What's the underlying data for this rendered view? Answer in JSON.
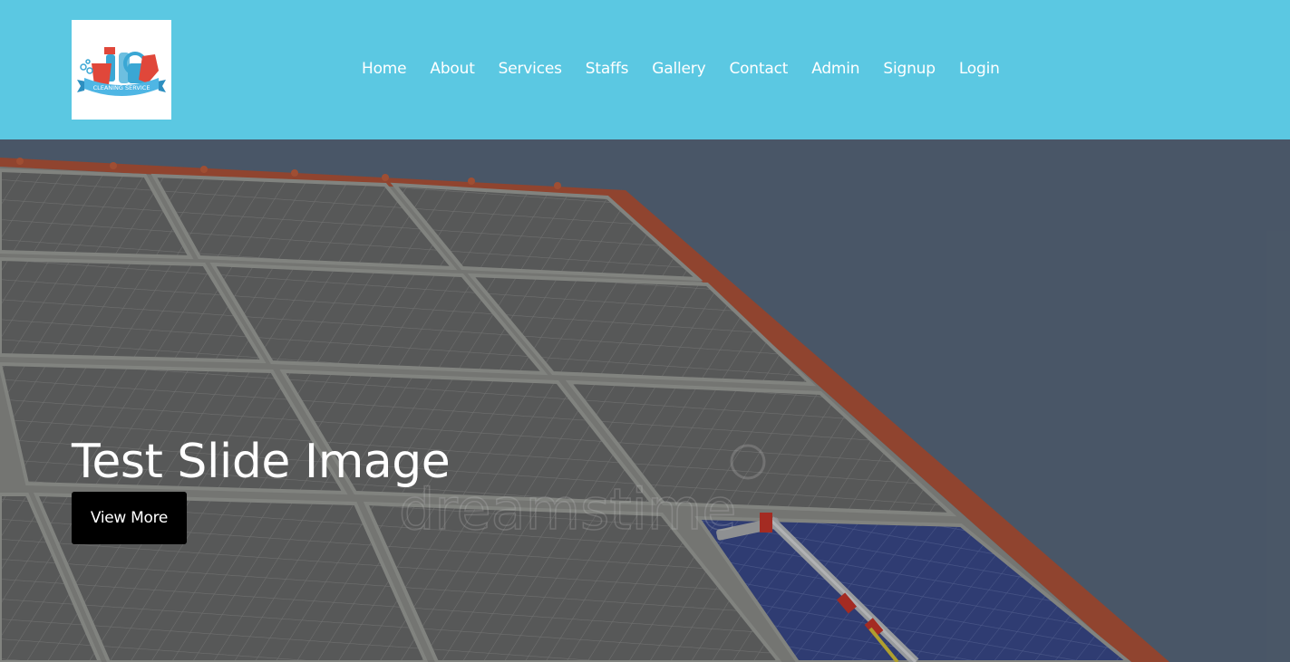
{
  "header": {
    "logo_text": "CLEANING SERVICE",
    "nav": [
      "Home",
      "About",
      "Services",
      "Staffs",
      "Gallery",
      "Contact",
      "Admin",
      "Signup",
      "Login"
    ]
  },
  "hero": {
    "title": "Test Slide Image",
    "button_label": "View More",
    "watermark": "dreamstime"
  },
  "colors": {
    "header_bg": "#5bc8e2",
    "button_bg": "#000000",
    "text": "#ffffff"
  }
}
